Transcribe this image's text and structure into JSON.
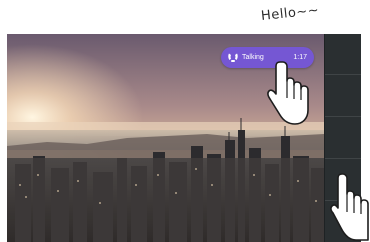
{
  "annotation": {
    "greeting_text": "Hello~~"
  },
  "call_pill": {
    "label": "Talking",
    "count": "1:17",
    "accent_color": "#7557d3",
    "icon": "phone-wave-icon"
  },
  "wallpaper": {
    "icon": "city-skyline-photo"
  },
  "gestures": {
    "tap_hand_icon": "pointing-hand-icon",
    "swipe_hand_icon": "pointing-hand-icon"
  },
  "side_panel": {
    "color": "#2a2f31"
  }
}
